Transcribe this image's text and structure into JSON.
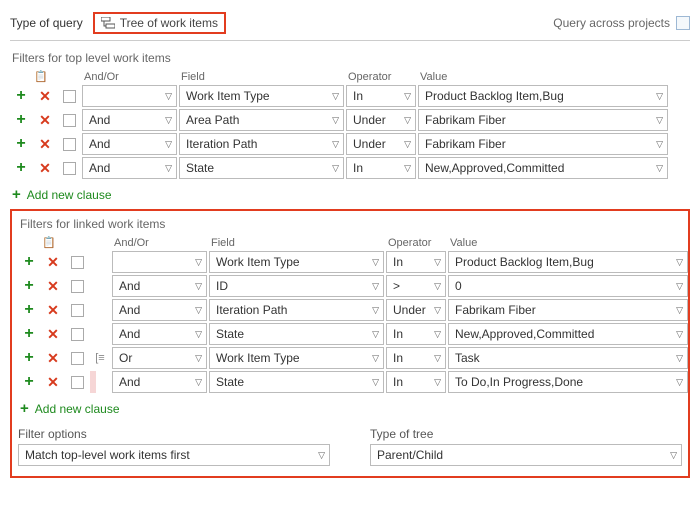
{
  "top": {
    "typeOfQuery_label": "Type of query",
    "querytype_value": "Tree of work items",
    "crossProjects_label": "Query across projects"
  },
  "sectionA": {
    "title": "Filters for top level work items",
    "headers": {
      "andor": "And/Or",
      "field": "Field",
      "operator": "Operator",
      "value": "Value"
    },
    "rows": [
      {
        "andor": "",
        "field": "Work Item Type",
        "operator": "In",
        "value": "Product Backlog Item,Bug"
      },
      {
        "andor": "And",
        "field": "Area Path",
        "operator": "Under",
        "value": "Fabrikam Fiber"
      },
      {
        "andor": "And",
        "field": "Iteration Path",
        "operator": "Under",
        "value": "Fabrikam Fiber"
      },
      {
        "andor": "And",
        "field": "State",
        "operator": "In",
        "value": "New,Approved,Committed"
      }
    ],
    "addnew": "Add new clause"
  },
  "sectionB": {
    "title": "Filters for linked work items",
    "headers": {
      "andor": "And/Or",
      "field": "Field",
      "operator": "Operator",
      "value": "Value"
    },
    "rows": [
      {
        "group": "",
        "andor": "",
        "field": "Work Item Type",
        "operator": "In",
        "value": "Product Backlog Item,Bug"
      },
      {
        "group": "",
        "andor": "And",
        "field": "ID",
        "operator": ">",
        "value": "0"
      },
      {
        "group": "",
        "andor": "And",
        "field": "Iteration Path",
        "operator": "Under",
        "value": "Fabrikam Fiber"
      },
      {
        "group": "",
        "andor": "And",
        "field": "State",
        "operator": "In",
        "value": "New,Approved,Committed"
      },
      {
        "group": "[",
        "andor": "Or",
        "field": "Work Item Type",
        "operator": "In",
        "value": "Task"
      },
      {
        "group": "indent",
        "andor": "And",
        "field": "State",
        "operator": "In",
        "value": "To Do,In Progress,Done"
      }
    ],
    "addnew": "Add new clause",
    "footer": {
      "filterOptions_label": "Filter options",
      "filterOptions_value": "Match top-level work items first",
      "typeOfTree_label": "Type of tree",
      "typeOfTree_value": "Parent/Child"
    }
  }
}
